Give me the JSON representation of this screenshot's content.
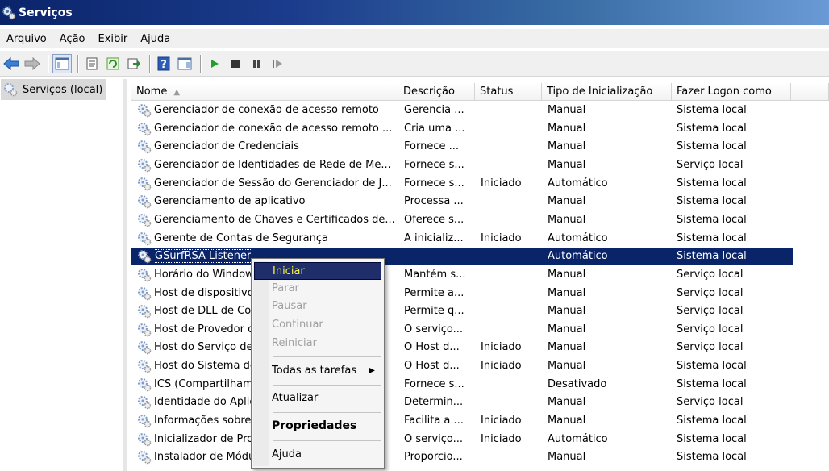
{
  "window": {
    "title": "Serviços"
  },
  "menubar": {
    "items": [
      "Arquivo",
      "Ação",
      "Exibir",
      "Ajuda"
    ]
  },
  "toolbar": {
    "icons": [
      "back-arrow-icon",
      "forward-arrow-icon",
      "show-hide-console-tree-icon",
      "properties-icon",
      "refresh-icon",
      "export-list-icon",
      "help-icon",
      "show-action-pane-icon",
      "play-icon",
      "stop-icon",
      "pause-icon",
      "restart-icon"
    ]
  },
  "tree": {
    "root_label": "Serviços (local)"
  },
  "columns": {
    "name": "Nome",
    "description": "Descrição",
    "status": "Status",
    "startup_type": "Tipo de Inicialização",
    "logon_as": "Fazer Logon como"
  },
  "rows": [
    {
      "name": "Gerenciador de conexão de acesso remoto",
      "description": "Gerencia ...",
      "status": "",
      "startup_type": "Manual",
      "logon_as": "Sistema local"
    },
    {
      "name": "Gerenciador de conexão de acesso remoto ...",
      "description": "Cria uma ...",
      "status": "",
      "startup_type": "Manual",
      "logon_as": "Sistema local"
    },
    {
      "name": "Gerenciador de Credenciais",
      "description": "Fornece ...",
      "status": "",
      "startup_type": "Manual",
      "logon_as": "Sistema local"
    },
    {
      "name": "Gerenciador de Identidades de Rede de Me...",
      "description": "Fornece s...",
      "status": "",
      "startup_type": "Manual",
      "logon_as": "Serviço local"
    },
    {
      "name": "Gerenciador de Sessão do Gerenciador de J...",
      "description": "Fornece s...",
      "status": "Iniciado",
      "startup_type": "Automático",
      "logon_as": "Sistema local"
    },
    {
      "name": "Gerenciamento de aplicativo",
      "description": "Processa ...",
      "status": "",
      "startup_type": "Manual",
      "logon_as": "Sistema local"
    },
    {
      "name": "Gerenciamento de Chaves e Certificados de...",
      "description": "Oferece s...",
      "status": "",
      "startup_type": "Manual",
      "logon_as": "Sistema local"
    },
    {
      "name": "Gerente de Contas de Segurança",
      "description": "A inicializ...",
      "status": "Iniciado",
      "startup_type": "Automático",
      "logon_as": "Sistema local"
    },
    {
      "name": "GSurfRSA Listener",
      "description": "",
      "status": "",
      "startup_type": "Automático",
      "logon_as": "Sistema local"
    },
    {
      "name": "Horário do Window",
      "description": "Mantém s...",
      "status": "",
      "startup_type": "Manual",
      "logon_as": "Serviço local"
    },
    {
      "name": "Host de dispositivo",
      "description": "Permite a...",
      "status": "",
      "startup_type": "Manual",
      "logon_as": "Serviço local"
    },
    {
      "name": "Host de DLL de Co",
      "description": "Permite q...",
      "status": "",
      "startup_type": "Manual",
      "logon_as": "Serviço local"
    },
    {
      "name": "Host de Provedor d",
      "description": "O serviço...",
      "status": "",
      "startup_type": "Manual",
      "logon_as": "Serviço local"
    },
    {
      "name": "Host do Serviço de",
      "description": "O Host d...",
      "status": "Iniciado",
      "startup_type": "Manual",
      "logon_as": "Serviço local"
    },
    {
      "name": "Host do Sistema de",
      "description": "O Host d...",
      "status": "Iniciado",
      "startup_type": "Manual",
      "logon_as": "Sistema local"
    },
    {
      "name": "ICS (Compartilham",
      "description": "Fornece s...",
      "status": "",
      "startup_type": "Desativado",
      "logon_as": "Sistema local"
    },
    {
      "name": "Identidade do Aplic",
      "description": "Determin...",
      "status": "",
      "startup_type": "Manual",
      "logon_as": "Serviço local"
    },
    {
      "name": "Informações sobre",
      "description": "Facilita a ...",
      "status": "Iniciado",
      "startup_type": "Manual",
      "logon_as": "Sistema local"
    },
    {
      "name": "Inicializador de Pro",
      "description": "O serviço...",
      "status": "Iniciado",
      "startup_type": "Automático",
      "logon_as": "Sistema local"
    },
    {
      "name": "Instalador de Módu",
      "description": "Proporcio...",
      "status": "",
      "startup_type": "Manual",
      "logon_as": "Sistema local"
    }
  ],
  "context_menu": {
    "iniciar": "Iniciar",
    "parar": "Parar",
    "pausar": "Pausar",
    "continuar": "Continuar",
    "reiniciar": "Reiniciar",
    "todas_tarefas": "Todas as tarefas",
    "atualizar": "Atualizar",
    "propriedades": "Propriedades",
    "ajuda": "Ajuda"
  }
}
